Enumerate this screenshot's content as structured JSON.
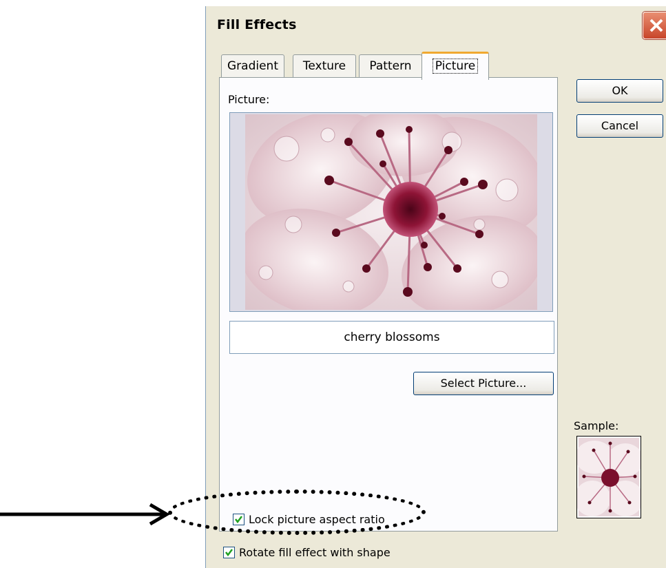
{
  "dialog": {
    "title": "Fill Effects",
    "tabs": [
      {
        "label": "Gradient"
      },
      {
        "label": "Texture"
      },
      {
        "label": "Pattern"
      },
      {
        "label": "Picture",
        "active": true
      }
    ],
    "picture_label": "Picture:",
    "picture_name": "cherry blossoms",
    "select_picture_label": "Select Picture...",
    "ok_label": "OK",
    "cancel_label": "Cancel",
    "sample_label": "Sample:",
    "lock_aspect_label": "Lock picture aspect ratio",
    "lock_aspect_checked": true,
    "rotate_label": "Rotate fill effect with shape",
    "rotate_checked": true
  },
  "icons": {
    "close": "close-icon",
    "check": "checkmark-icon",
    "arrow": "arrow-right-icon"
  },
  "colors": {
    "dialog_bg": "#ece9d8",
    "active_tab_accent": "#f0a830",
    "close_button": "#c8452a",
    "check_mark": "#21a121"
  }
}
